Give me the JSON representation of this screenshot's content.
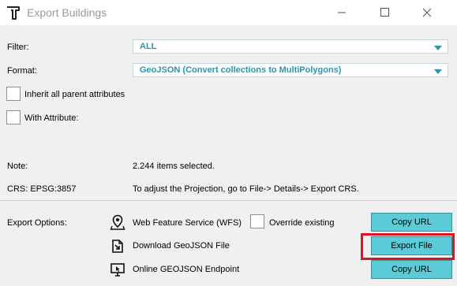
{
  "window": {
    "title": "Export Buildings"
  },
  "form": {
    "filter_label": "Filter:",
    "filter_value": "ALL",
    "format_label": "Format:",
    "format_value": "GeoJSON (Convert collections to MultiPolygons)",
    "inherit_label": "Inherit all parent attributes",
    "inherit_checked": false,
    "with_attribute_label": "With Attribute:",
    "with_attribute_checked": false
  },
  "info": {
    "note_label": "Note:",
    "note_value": "2.244 items selected.",
    "crs_label": "CRS: EPSG:3857",
    "crs_value": "To adjust the Projection, go to File-> Details-> Export CRS."
  },
  "export": {
    "section_label": "Export Options:",
    "wfs_label": "Web Feature Service (WFS)",
    "override_label": "Override existing",
    "override_checked": false,
    "copy_url_label": "Copy URL",
    "download_label": "Download GeoJSON File",
    "export_file_label": "Export File",
    "endpoint_label": "Online GEOJSON Endpoint",
    "copy_url2_label": "Copy URL"
  },
  "colors": {
    "accent": "#2b95b1",
    "button_fill": "#5bcbd8",
    "highlight_border": "#e0121e"
  },
  "icons": {
    "app": "tygron-t-logo-icon",
    "wfs": "map-pin-icon",
    "download": "file-download-icon",
    "endpoint": "monitor-cursor-icon"
  }
}
